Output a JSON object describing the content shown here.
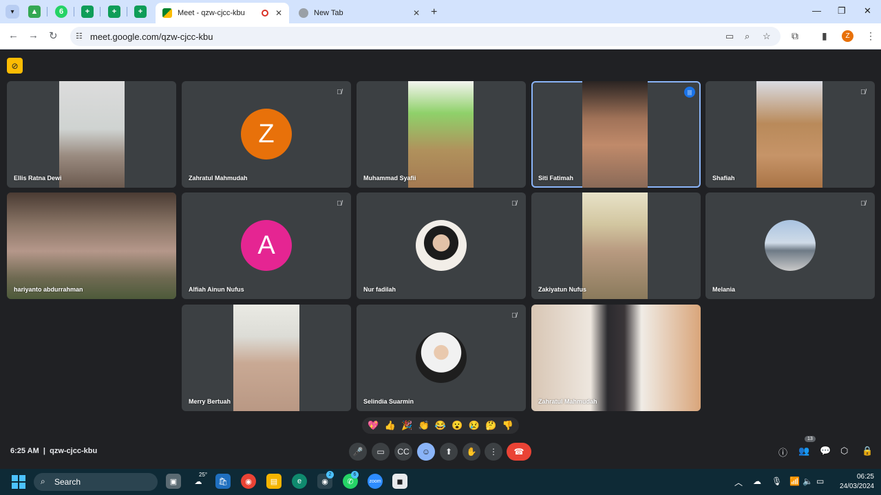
{
  "browser": {
    "tabs": [
      {
        "title": "Meet - qzw-cjcc-kbu",
        "recording": true
      },
      {
        "title": "New Tab"
      }
    ],
    "pinned_badge": "6",
    "url": "meet.google.com/qzw-cjcc-kbu",
    "profile_initial": "Z"
  },
  "meet": {
    "participants": [
      {
        "name": "Ellis Ratna Dewi",
        "muted": false,
        "video": true
      },
      {
        "name": "Zahratul Mahmudah",
        "muted": true,
        "video": false,
        "initial": "Z",
        "color": "#e8710a"
      },
      {
        "name": "Muhammad Syafii",
        "muted": false,
        "video": true
      },
      {
        "name": "Siti Fatimah",
        "muted": false,
        "video": true,
        "speaking": true
      },
      {
        "name": "Shafiah",
        "muted": true,
        "video": true
      },
      {
        "name": "hariyanto abdurrahman",
        "muted": false,
        "video": true
      },
      {
        "name": "Alfiah Ainun Nufus",
        "muted": true,
        "video": false,
        "initial": "A",
        "color": "#e52592"
      },
      {
        "name": "Nur fadilah",
        "muted": true,
        "video": false
      },
      {
        "name": "Zakiyatun Nufus",
        "muted": false,
        "video": true
      },
      {
        "name": "Melania",
        "muted": true,
        "video": false
      },
      {
        "name": "Merry Bertuah",
        "muted": false,
        "video": true
      },
      {
        "name": "Selindia Suarmin",
        "muted": true,
        "video": false
      },
      {
        "name": "Zahratul Mahmudah",
        "muted": false,
        "video": true
      }
    ],
    "reactions": [
      "💖",
      "👍",
      "🎉",
      "👏",
      "😂",
      "😮",
      "😢",
      "🤔",
      "👎"
    ],
    "time": "6:25 AM",
    "separator": "|",
    "meeting_code": "qzw-cjcc-kbu",
    "people_count": "13"
  },
  "taskbar": {
    "search_label": "Search",
    "weather": "25°",
    "chrome_badge": "2",
    "whatsapp_badge": "6",
    "zoom_label": "zoom",
    "time": "06:25",
    "date": "24/03/2024"
  }
}
